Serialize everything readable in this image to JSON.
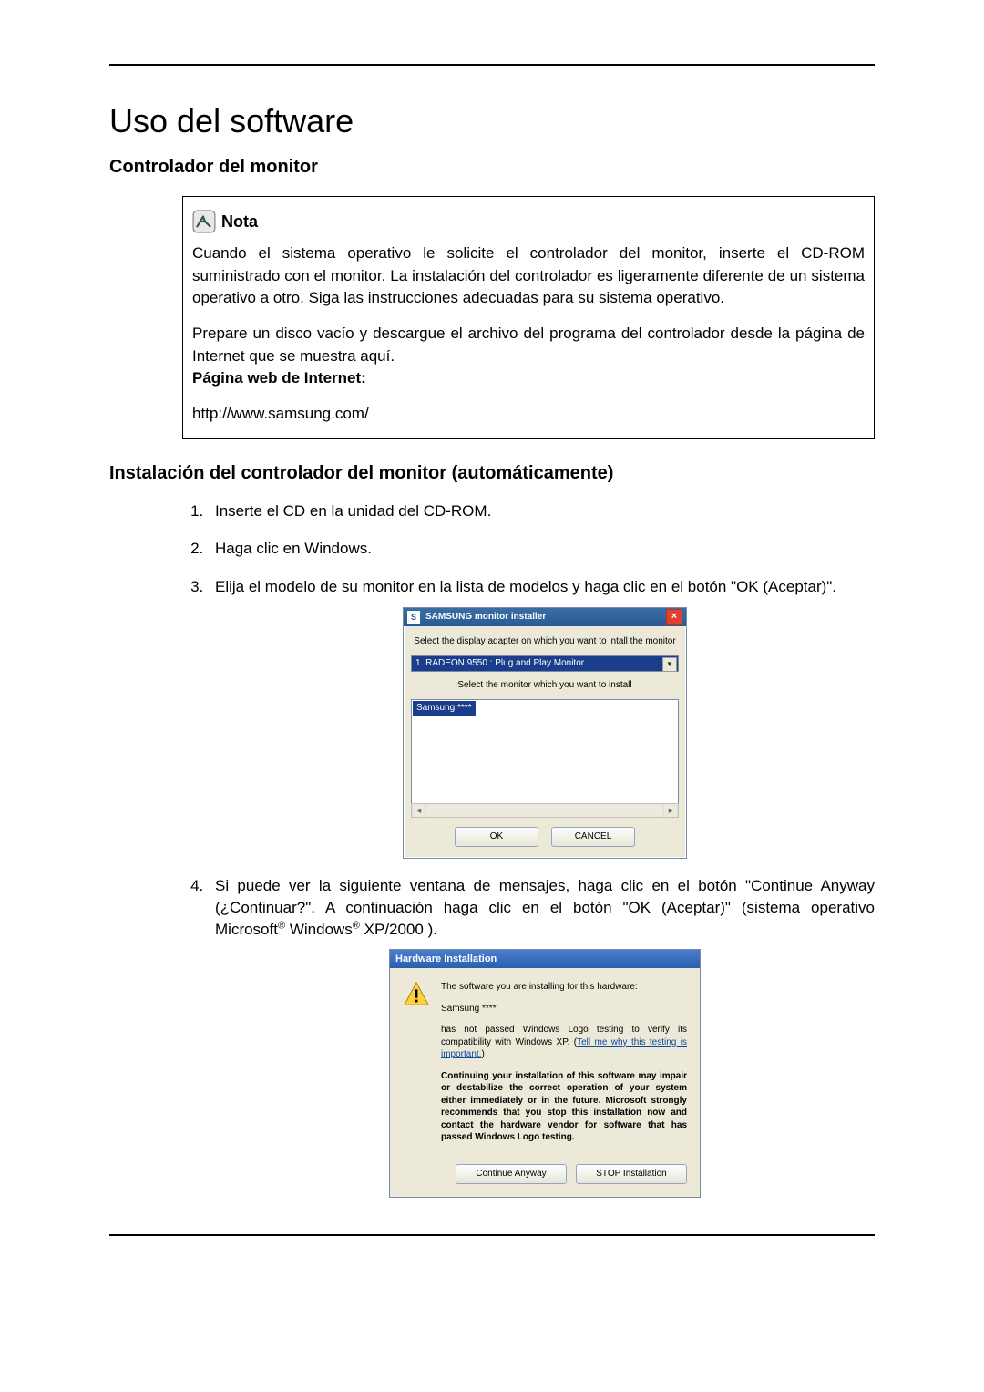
{
  "page": {
    "title": "Uso del software",
    "section": "Controlador del monitor",
    "subsection": "Instalación del controlador del monitor (automáticamente)"
  },
  "note": {
    "heading": "Nota",
    "para1": "Cuando el sistema operativo le solicite el controlador del monitor, inserte el CD-ROM suministrado con el monitor. La instalación del controlador es ligeramente diferente de un sistema operativo a otro. Siga las instrucciones adecuadas para su sistema operativo.",
    "para2": "Prepare un disco vacío y descargue el archivo del programa del controlador desde la página de Internet que se muestra aquí.",
    "pagina_label": "Página web de Internet:",
    "url": "http://www.samsung.com/"
  },
  "steps": {
    "s1": "Inserte el CD en la unidad del CD-ROM.",
    "s2": "Haga clic en Windows.",
    "s3": "Elija el modelo de su monitor en la lista de modelos y haga clic en el botón \"OK (Aceptar)\".",
    "s4_a": "Si puede ver la siguiente ventana de mensajes, haga clic en el botón \"Continue Anyway (¿Continuar?\". A continuación haga clic en el botón \"OK (Aceptar)\" (sistema operativo Microsoft",
    "s4_b": " Windows",
    "s4_c": " XP/2000 )."
  },
  "dlg_installer": {
    "title": "SAMSUNG monitor installer",
    "label1": "Select the display adapter on which you want to intall the monitor",
    "adapter": "1. RADEON 9550 : Plug and Play Monitor",
    "label2": "Select the monitor which you want to install",
    "selected_item": "Samsung ****",
    "ok": "OK",
    "cancel": "CANCEL"
  },
  "dlg_hw": {
    "title": "Hardware Installation",
    "line1": "The software you are installing for this hardware:",
    "line2": "Samsung ****",
    "line3a": "has not passed Windows Logo testing to verify its compatibility with Windows XP. (",
    "link": "Tell me why this testing is important.",
    "line3b": ")",
    "bold": "Continuing your installation of this software may impair or destabilize the correct operation of your system either immediately or in the future. Microsoft strongly recommends that you stop this installation now and contact the hardware vendor for software that has passed Windows Logo testing.",
    "btn_continue": "Continue Anyway",
    "btn_stop": "STOP Installation"
  }
}
